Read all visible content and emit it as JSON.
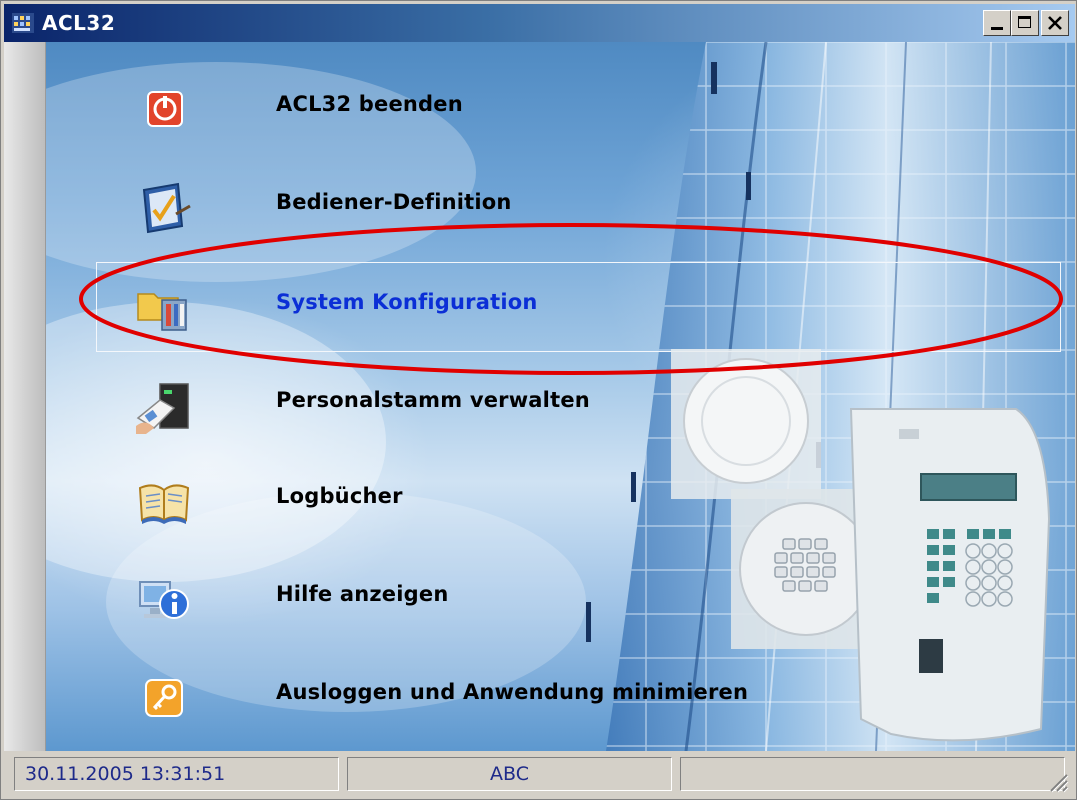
{
  "window": {
    "title": "ACL32"
  },
  "menu": {
    "items": [
      {
        "label": "ACL32 beenden",
        "icon": "power-icon"
      },
      {
        "label": "Bediener-Definition",
        "icon": "checklist-icon"
      },
      {
        "label": "System Konfiguration",
        "icon": "folder-config-icon",
        "selected": true
      },
      {
        "label": "Personalstamm verwalten",
        "icon": "card-reader-icon"
      },
      {
        "label": "Logbücher",
        "icon": "book-icon"
      },
      {
        "label": "Hilfe anzeigen",
        "icon": "info-icon"
      },
      {
        "label": "Ausloggen und Anwendung minimieren",
        "icon": "key-icon"
      }
    ]
  },
  "statusbar": {
    "datetime": "30.11.2005 13:31:51",
    "user": "ABC",
    "extra": ""
  },
  "colors": {
    "selected_label": "#0b2fd6",
    "highlight_ellipse": "#e00000",
    "titlebar": "#0a246a",
    "status_text": "#1e2a8a"
  }
}
